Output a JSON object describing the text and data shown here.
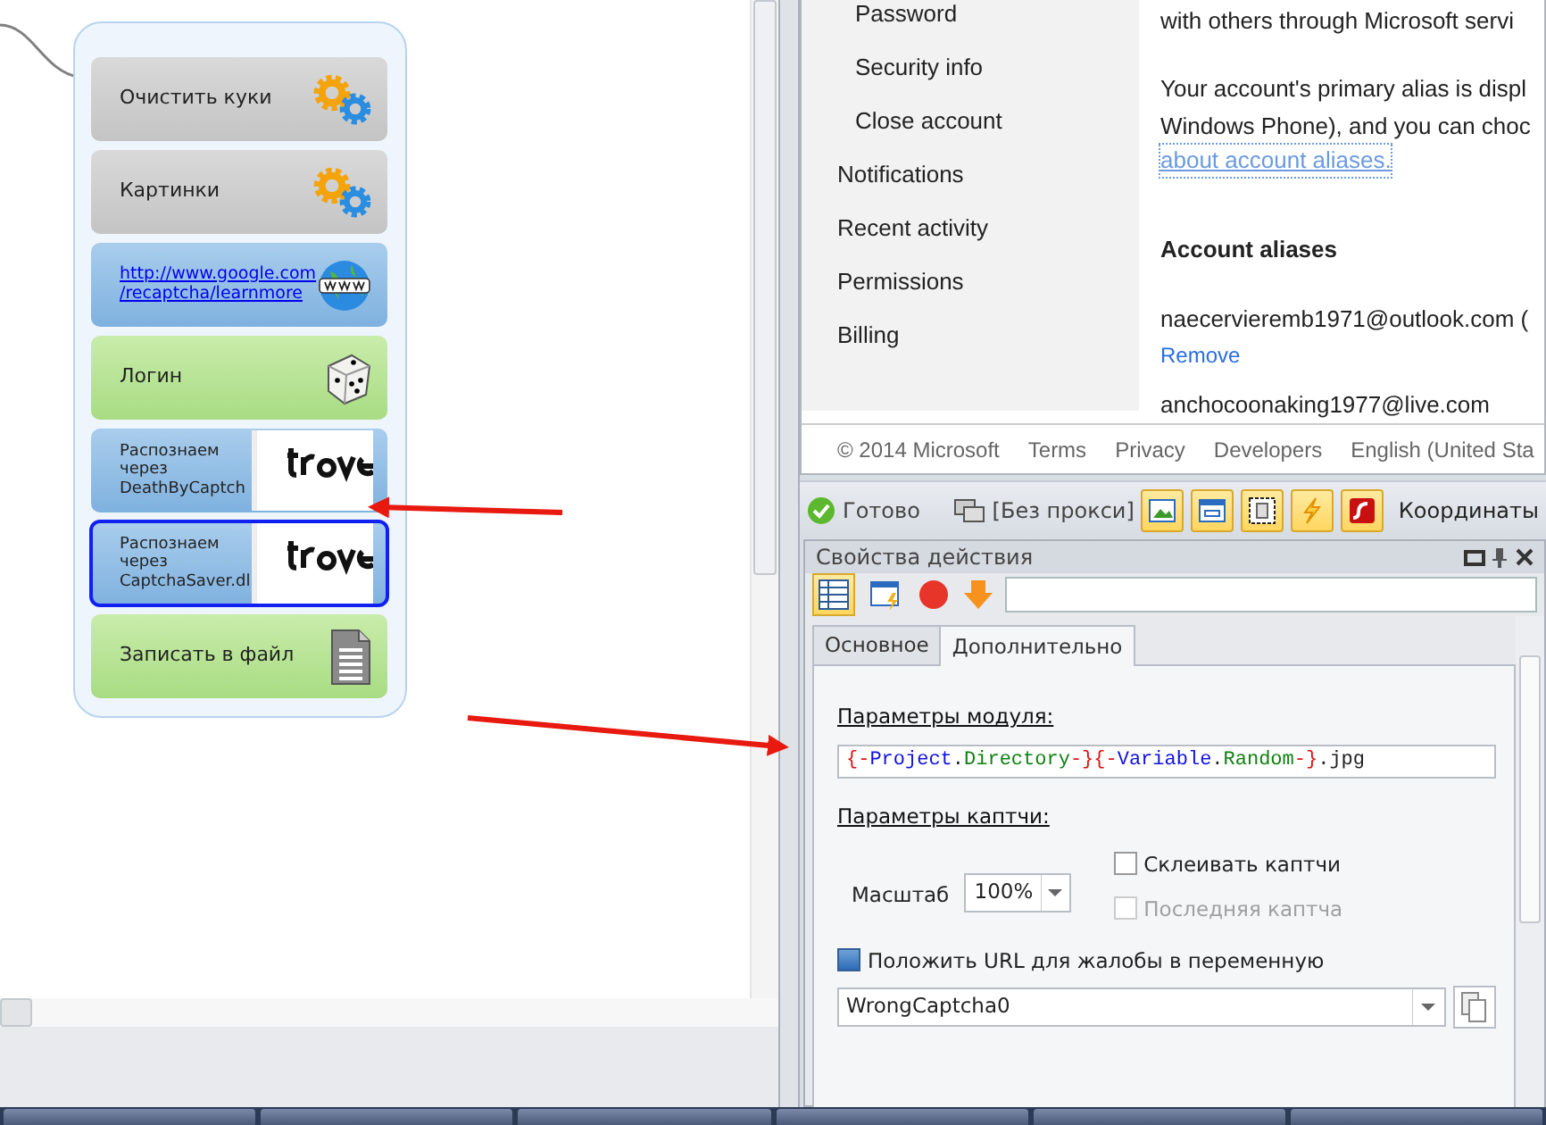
{
  "canvas": {
    "nodes": [
      {
        "kind": "action",
        "lines": [
          "Очистить куки"
        ],
        "selected": false
      },
      {
        "kind": "action",
        "lines": [
          "Картинки"
        ],
        "selected": false
      },
      {
        "kind": "link",
        "lines": [
          "http://www.google.com",
          "/recaptcha/learnmore"
        ],
        "selected": false
      },
      {
        "kind": "login",
        "lines": [
          "Логин"
        ],
        "selected": false
      },
      {
        "kind": "captcha",
        "lines": [
          "Распознаем",
          "через",
          "DeathByCaptch"
        ],
        "selected": false
      },
      {
        "kind": "captcha",
        "lines": [
          "Распознаем",
          "через",
          "CaptchaSaver.dl"
        ],
        "selected": true
      },
      {
        "kind": "file",
        "lines": [
          "Записать в файл"
        ],
        "selected": false
      }
    ]
  },
  "browser": {
    "sidebar": [
      {
        "kind": "sub",
        "label": "Password"
      },
      {
        "kind": "sub",
        "label": "Security info"
      },
      {
        "kind": "sub",
        "label": "Close account"
      },
      {
        "kind": "main",
        "label": "Notifications"
      },
      {
        "kind": "main",
        "label": "Recent activity"
      },
      {
        "kind": "main",
        "label": "Permissions"
      },
      {
        "kind": "main",
        "label": "Billing"
      }
    ],
    "intro": "with others through Microsoft servi",
    "alias_text": [
      "Your account's primary alias is displ",
      "Windows Phone), and you can choc"
    ],
    "alias_link": "about account aliases.",
    "heading": "Account aliases",
    "aliases": [
      {
        "address": "naecervieremb1971@outlook.com (",
        "action": "Remove"
      },
      {
        "address": "anchocoonaking1977@live.com"
      }
    ],
    "footer": [
      "© 2014 Microsoft",
      "Terms",
      "Privacy",
      "Developers",
      "English (United Sta"
    ]
  },
  "status_bar": {
    "status": "Готово",
    "proxy": "[Без прокси]",
    "coordinates": "Координаты"
  },
  "panel": {
    "title": "Свойства действия",
    "view_buttons": [
      {
        "selected": true
      },
      {
        "selected": false
      }
    ],
    "tabs": [
      {
        "label": "Основное",
        "selected": false
      },
      {
        "label": "Дополнительно",
        "selected": true
      }
    ],
    "module_section": "Параметры модуля:",
    "path_parts": [
      {
        "text": "{-",
        "color": "#e01010"
      },
      {
        "text": "Project",
        "color": "#1010e0"
      },
      {
        "text": ".",
        "color": "#222222"
      },
      {
        "text": "Directory",
        "color": "#108010"
      },
      {
        "text": "-}",
        "color": "#e01010"
      },
      {
        "text": "{-",
        "color": "#e01010"
      },
      {
        "text": "Variable",
        "color": "#1010e0"
      },
      {
        "text": ".",
        "color": "#222222"
      },
      {
        "text": "Random",
        "color": "#108010"
      },
      {
        "text": "-}",
        "color": "#e01010"
      },
      {
        "text": ".jpg",
        "color": "#222222"
      }
    ],
    "captcha_section": "Параметры каптчи:",
    "scale_label": "Масштаб",
    "scale": "100%",
    "checks": [
      {
        "label": "Склеивать каптчи",
        "checked": false,
        "disabled": false
      },
      {
        "label": "Последняя каптча",
        "checked": false,
        "disabled": true
      }
    ],
    "url_check": {
      "label": "Положить URL для жалобы в переменную",
      "checked": true
    },
    "variable": "WrongCaptcha0"
  }
}
